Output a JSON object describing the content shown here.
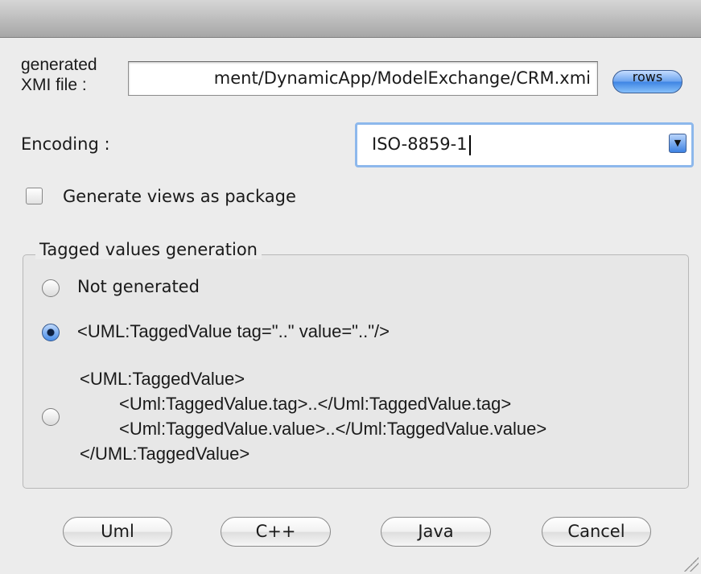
{
  "xmi_file": {
    "label_line1": "generated",
    "label_line2": "XMI file :",
    "value": "ment/DynamicApp/ModelExchange/CRM.xmi",
    "browse_label": "rows"
  },
  "encoding": {
    "label": "Encoding :",
    "selected": "ISO-8859-1"
  },
  "views_as_package": {
    "label": "Generate views as package",
    "checked": false
  },
  "tagged_values": {
    "legend": "Tagged values generation",
    "options": [
      {
        "label": "Not generated",
        "checked": false
      },
      {
        "label": "<UML:TaggedValue tag=\"..\" value=\"..\"/>",
        "checked": true
      },
      {
        "lines": [
          "<UML:TaggedValue>",
          "<Uml:TaggedValue.tag>..</Uml:TaggedValue.tag>",
          "<Uml:TaggedValue.value>..</Uml:TaggedValue.value>",
          "</UML:TaggedValue>"
        ],
        "checked": false
      }
    ]
  },
  "buttons": {
    "uml": "Uml",
    "cpp": "C++",
    "java": "Java",
    "cancel": "Cancel"
  },
  "colors": {
    "accent": "#3f85e4",
    "focus_ring": "#8db8ec",
    "window_bg": "#ececec"
  }
}
